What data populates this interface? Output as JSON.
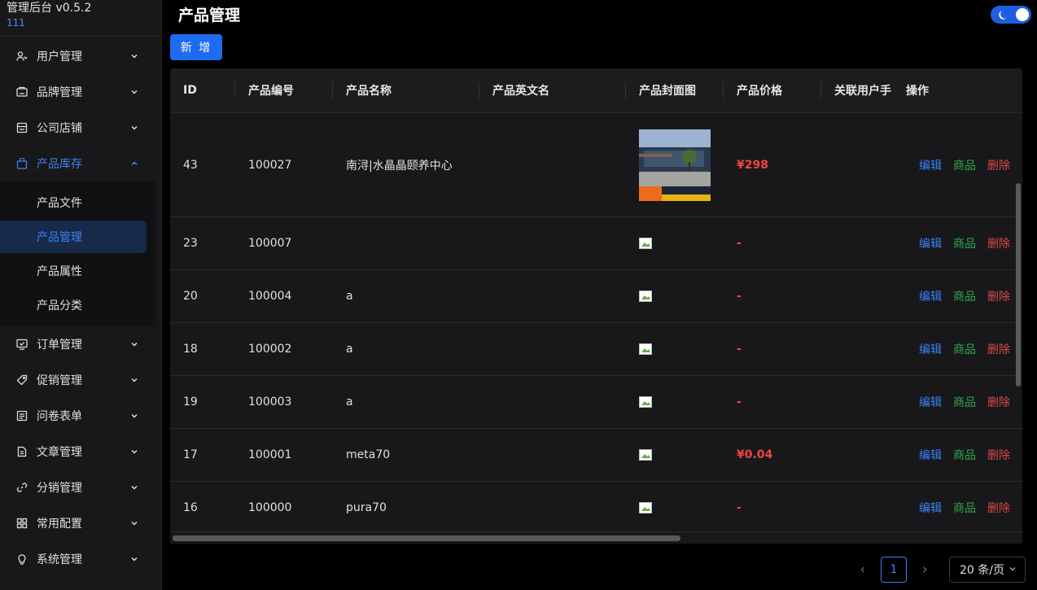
{
  "app": {
    "title": "管理后台 v0.5.2",
    "user": "111"
  },
  "sidebar": {
    "items": [
      {
        "label": "用户管理",
        "icon": "users-icon"
      },
      {
        "label": "品牌管理",
        "icon": "brand-icon"
      },
      {
        "label": "公司店铺",
        "icon": "store-icon"
      },
      {
        "label": "产品库存",
        "icon": "bag-icon",
        "expanded": true,
        "children": [
          "产品文件",
          "产品管理",
          "产品属性",
          "产品分类"
        ],
        "selected_child": "产品管理"
      },
      {
        "label": "订单管理",
        "icon": "order-icon"
      },
      {
        "label": "促销管理",
        "icon": "tag-icon"
      },
      {
        "label": "问卷表单",
        "icon": "form-icon"
      },
      {
        "label": "文章管理",
        "icon": "article-icon"
      },
      {
        "label": "分销管理",
        "icon": "link-icon"
      },
      {
        "label": "常用配置",
        "icon": "grid-icon"
      },
      {
        "label": "系统管理",
        "icon": "bulb-icon"
      }
    ]
  },
  "page": {
    "title": "产品管理",
    "add_label": "新 增"
  },
  "table": {
    "columns": [
      "ID",
      "产品编号",
      "产品名称",
      "产品英文名",
      "产品封面图",
      "产品价格",
      "关联用户手",
      "操作"
    ],
    "actions": {
      "edit": "编辑",
      "goods": "商品",
      "delete": "删除"
    },
    "rows": [
      {
        "id": "43",
        "code": "100027",
        "name": "南浔|水晶晶颐养中心",
        "en_name": "",
        "cover": "photo",
        "price": "¥298",
        "user": ""
      },
      {
        "id": "23",
        "code": "100007",
        "name": "",
        "en_name": "",
        "cover": "broken",
        "price": "-",
        "user": ""
      },
      {
        "id": "20",
        "code": "100004",
        "name": "a",
        "en_name": "",
        "cover": "broken",
        "price": "-",
        "user": ""
      },
      {
        "id": "18",
        "code": "100002",
        "name": "a",
        "en_name": "",
        "cover": "broken",
        "price": "-",
        "user": ""
      },
      {
        "id": "19",
        "code": "100003",
        "name": "a",
        "en_name": "",
        "cover": "broken",
        "price": "-",
        "user": ""
      },
      {
        "id": "17",
        "code": "100001",
        "name": "meta70",
        "en_name": "",
        "cover": "broken",
        "price": "¥0.04",
        "user": ""
      },
      {
        "id": "16",
        "code": "100000",
        "name": "pura70",
        "en_name": "",
        "cover": "broken",
        "price": "-",
        "user": ""
      }
    ]
  },
  "pagination": {
    "current": "1",
    "page_size": "20 条/页"
  },
  "colors": {
    "accent": "#3b82f6",
    "price": "#ef4444",
    "goods": "#2fa84f",
    "delete": "#d94949"
  }
}
